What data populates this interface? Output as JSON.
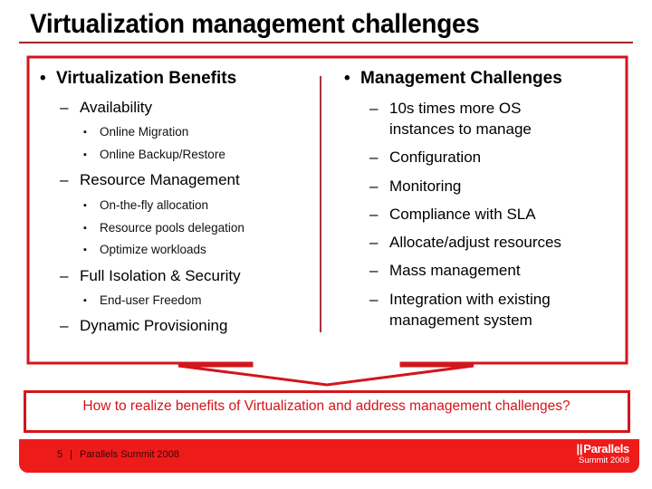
{
  "slide": {
    "title": "Virtualization management challenges",
    "colors": {
      "accent_red": "#d4141a",
      "footer_red": "#ee1b1b",
      "rule_dark_red": "#9e2a2a"
    }
  },
  "left_column": {
    "heading": "Virtualization Benefits",
    "bullet_glyph": "•",
    "items": [
      {
        "label": "Availability",
        "subitems": [
          "Online Migration",
          "Online Backup/Restore"
        ]
      },
      {
        "label": "Resource Management",
        "subitems": [
          "On-the-fly allocation",
          "Resource pools delegation",
          "Optimize workloads"
        ]
      },
      {
        "label": "Full Isolation & Security",
        "subitems": [
          "End-user Freedom"
        ]
      },
      {
        "label": "Dynamic Provisioning",
        "subitems": []
      }
    ]
  },
  "right_column": {
    "heading": "Management Challenges",
    "items": [
      "10s times more OS instances to manage",
      "Configuration",
      "Monitoring",
      "Compliance with SLA",
      "Allocate/adjust resources",
      "Mass management",
      "Integration with existing management system"
    ]
  },
  "glyphs": {
    "level1": "•",
    "level2": "–",
    "level3": "▪"
  },
  "question": "How to realize benefits of Virtualization and address management challenges?",
  "footer": {
    "page_number": "5",
    "separator": "|",
    "event": "Parallels Summit 2008",
    "logo_bars": "||",
    "logo_name": "Parallels",
    "logo_sub": "Summit 2008"
  }
}
